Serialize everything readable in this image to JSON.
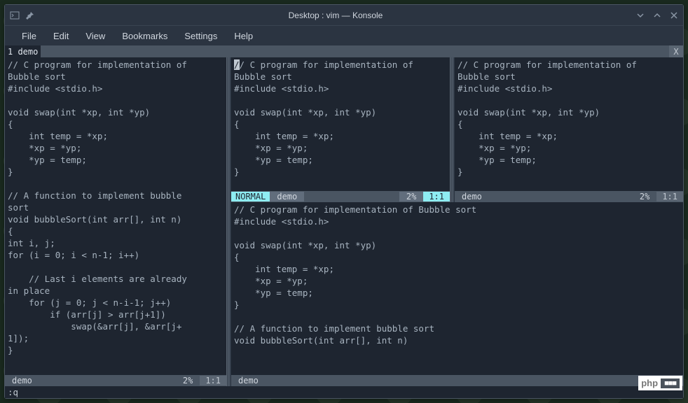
{
  "title": "Desktop : vim — Konsole",
  "menu": [
    "File",
    "Edit",
    "View",
    "Bookmarks",
    "Settings",
    "Help"
  ],
  "tab": "1 demo",
  "tab_close": "X",
  "code_left": "// C program for implementation of\nBubble sort\n#include <stdio.h>\n\nvoid swap(int *xp, int *yp)\n{\n    int temp = *xp;\n    *xp = *yp;\n    *yp = temp;\n}\n\n// A function to implement bubble\nsort\nvoid bubbleSort(int arr[], int n)\n{\nint i, j;\nfor (i = 0; i < n-1; i++)\n\n    // Last i elements are already\nin place\n    for (j = 0; j < n-i-1; j++)\n        if (arr[j] > arr[j+1])\n            swap(&arr[j], &arr[j+\n1]);\n}",
  "code_top_mid_first": "/",
  "code_top_mid_rest": "/ C program for implementation of\nBubble sort\n#include <stdio.h>\n\nvoid swap(int *xp, int *yp)\n{\n    int temp = *xp;\n    *xp = *yp;\n    *yp = temp;\n}\n",
  "code_top_right": "// C program for implementation of\nBubble sort\n#include <stdio.h>\n\nvoid swap(int *xp, int *yp)\n{\n    int temp = *xp;\n    *xp = *yp;\n    *yp = temp;\n}\n",
  "at": "@",
  "code_bottom": "// C program for implementation of Bubble sort\n#include <stdio.h>\n\nvoid swap(int *xp, int *yp)\n{\n    int temp = *xp;\n    *xp = *yp;\n    *yp = temp;\n}\n\n// A function to implement bubble sort\nvoid bubbleSort(int arr[], int n)",
  "status": {
    "mode": "NORMAL",
    "file": "demo",
    "pct": "2%",
    "pos": "1:1"
  },
  "cmd": ":q",
  "wm1": "php",
  "wm2": "■■■"
}
